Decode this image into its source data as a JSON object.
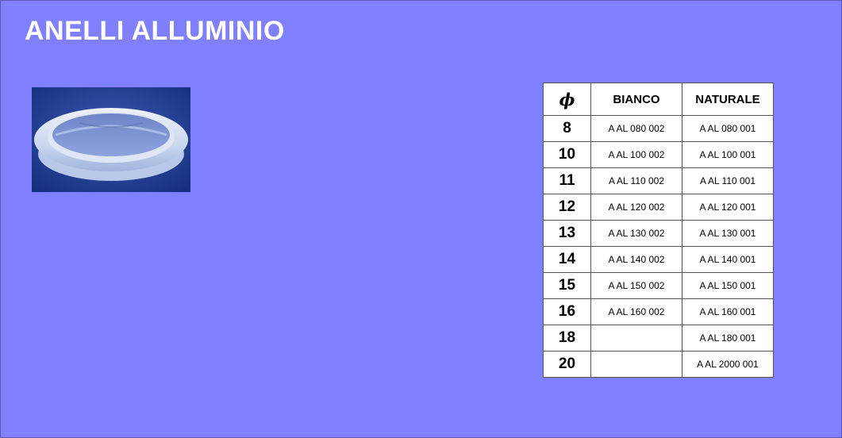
{
  "title": "ANELLI ALLUMINIO",
  "product_image": {
    "icon": "white-ring-photo"
  },
  "table": {
    "headers": {
      "diameter": "ϕ",
      "bianco": "BIANCO",
      "naturale": "NATURALE"
    },
    "rows": [
      {
        "diameter": "8",
        "bianco": "A AL 080 002",
        "naturale": "A AL 080 001"
      },
      {
        "diameter": "10",
        "bianco": "A AL 100 002",
        "naturale": "A AL 100 001"
      },
      {
        "diameter": "11",
        "bianco": "A AL 110 002",
        "naturale": "A AL 110 001"
      },
      {
        "diameter": "12",
        "bianco": "A AL 120 002",
        "naturale": "A AL 120 001"
      },
      {
        "diameter": "13",
        "bianco": "A AL 130 002",
        "naturale": "A AL 130 001"
      },
      {
        "diameter": "14",
        "bianco": "A AL 140 002",
        "naturale": "A AL 140 001"
      },
      {
        "diameter": "15",
        "bianco": "A AL 150 002",
        "naturale": "A AL 150 001"
      },
      {
        "diameter": "16",
        "bianco": "A AL 160 002",
        "naturale": "A AL 160 001"
      },
      {
        "diameter": "18",
        "bianco": "",
        "naturale": "A AL 180 001"
      },
      {
        "diameter": "20",
        "bianco": "",
        "naturale": "A AL 2000 001"
      }
    ]
  },
  "colors": {
    "background": "#8080ff",
    "title": "#ffffff",
    "table_background": "#ffffff",
    "photo_background": "#1e3c96"
  }
}
